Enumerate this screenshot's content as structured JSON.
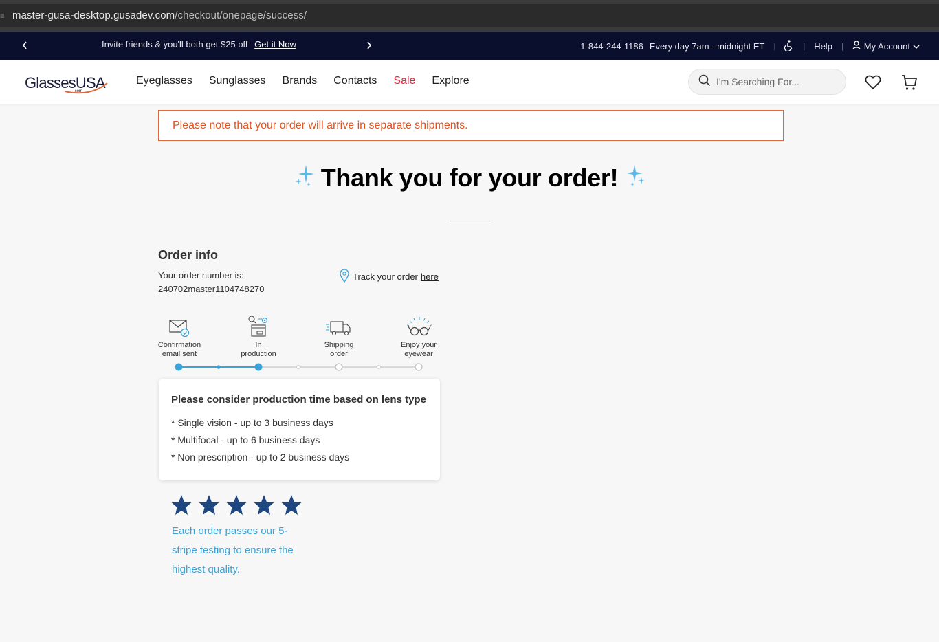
{
  "browser": {
    "url_host": "master-gusa-desktop.gusadev.com",
    "url_path": "/checkout/onepage/success/"
  },
  "topbar": {
    "promo_text": "Invite friends & you'll both get $25 off",
    "promo_link": "Get it Now",
    "phone": "1-844-244-1186",
    "hours": "Every day 7am - midnight ET",
    "help": "Help",
    "account": "My Account",
    "bg_color": "#0b0f2e"
  },
  "header": {
    "logo_text": "GlassesUSA",
    "logo_com": ".com",
    "nav": [
      "Eyeglasses",
      "Sunglasses",
      "Brands",
      "Contacts",
      "Sale",
      "Explore"
    ],
    "search_placeholder": "I'm Searching For...",
    "sale_color": "#e8223a"
  },
  "notice": {
    "text": "Please note that your order will arrive in separate shipments."
  },
  "title": "Thank you for your order!",
  "order": {
    "heading": "Order info",
    "number_label": "Your order number is:",
    "number": "240702master1104748270",
    "track_text": "Track your order",
    "track_link": "here"
  },
  "steps": [
    {
      "label_1": "Confirmation",
      "label_2": "email sent",
      "icon": "envelope-check-icon",
      "done": true
    },
    {
      "label_1": "In",
      "label_2": "production",
      "icon": "production-icon",
      "done": true
    },
    {
      "label_1": "Shipping",
      "label_2": "order",
      "icon": "truck-icon",
      "done": false
    },
    {
      "label_1": "Enjoy your",
      "label_2": "eyewear",
      "icon": "eyewear-icon",
      "done": false
    }
  ],
  "production_card": {
    "heading": "Please consider production time based on lens type",
    "lines": [
      "* Single vision - up to 3 business days",
      "* Multifocal - up to 6 business days",
      "* Non prescription - up to 2 business days"
    ]
  },
  "quality": {
    "stars": 5,
    "text": "Each order passes our 5-stripe testing to ensure the highest quality.",
    "star_color": "#1d4780",
    "text_color": "#3aa3d8"
  },
  "accent_color": "#3aa3d8"
}
